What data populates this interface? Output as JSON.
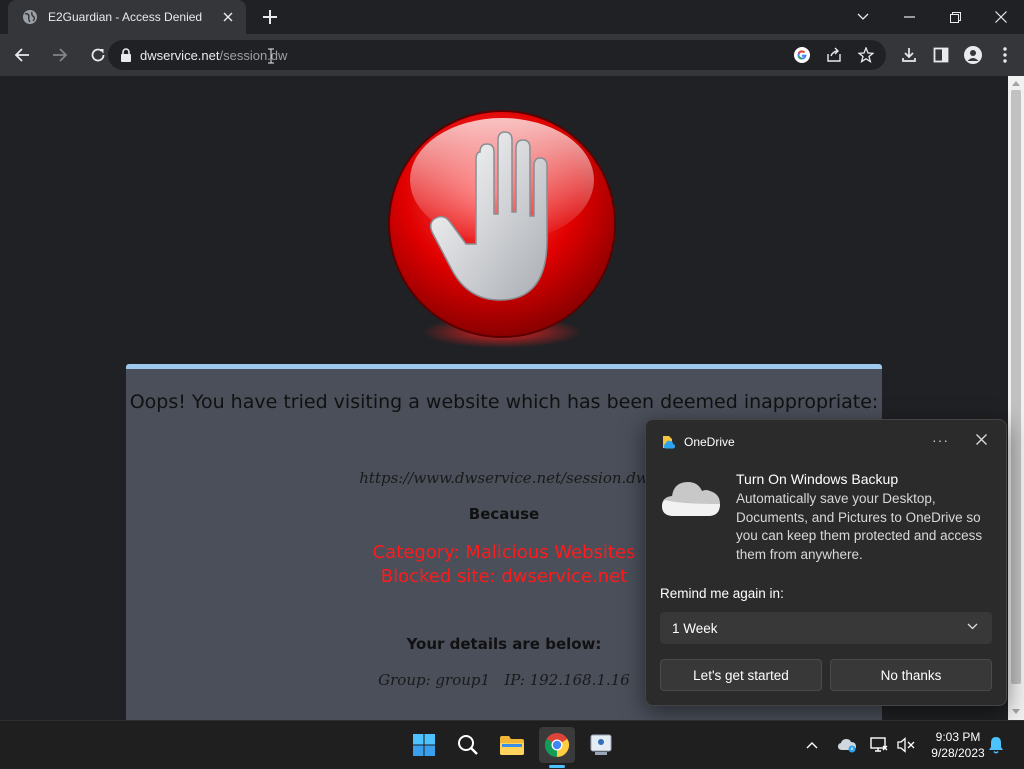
{
  "browser": {
    "tab": {
      "title": "E2Guardian - Access Denied"
    },
    "url": {
      "host": "dwservice.net",
      "path": "/session.dw"
    }
  },
  "page": {
    "heading": "Oops! You have tried visiting a website which has been deemed inappropriate:",
    "blocked_url": "https://www.dwservice.net/session.dw",
    "because_label": "Because",
    "category_line": "Category: Malicious Websites",
    "blocked_site_line": "Blocked site: dwservice.net",
    "details_heading": "Your details are below:",
    "details_line": "Group: group1   IP: 192.168.1.16"
  },
  "notification": {
    "app_name": "OneDrive",
    "more_label": "···",
    "title": "Turn On Windows Backup",
    "body": "Automatically save your Desktop, Documents, and Pictures to OneDrive so you can keep them protected and access them from anywhere.",
    "remind_label": "Remind me again in:",
    "remind_value": "1 Week",
    "primary_button": "Let's get started",
    "secondary_button": "No thanks"
  },
  "taskbar": {
    "time": "9:03 PM",
    "date": "9/28/2023",
    "apps": [
      "start",
      "search",
      "file-explorer",
      "chrome",
      "remote-desktop"
    ]
  },
  "colors": {
    "blocked_reason": "#ff1b1b",
    "panel_border": "#9ec9ee",
    "accent": "#4cc2ff"
  }
}
